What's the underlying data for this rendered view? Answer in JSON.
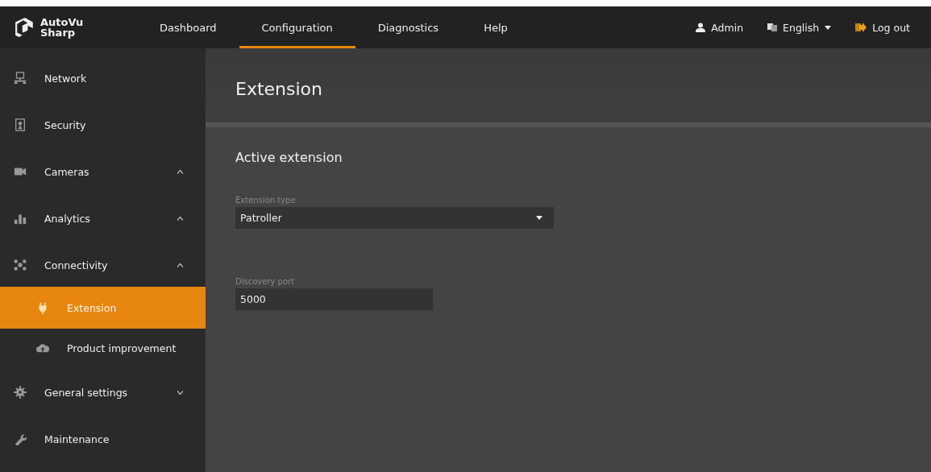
{
  "brand": {
    "line_1": "AutoVu",
    "line_2": "Sharp"
  },
  "nav": [
    {
      "label": "Dashboard",
      "selected": false
    },
    {
      "label": "Configuration",
      "selected": true
    },
    {
      "label": "Diagnostics",
      "selected": false
    },
    {
      "label": "Help",
      "selected": false
    }
  ],
  "user_menu": {
    "user": "Admin",
    "language": "English",
    "logout": "Log out"
  },
  "sidebar": {
    "items": [
      {
        "label": "Network",
        "kind": "network",
        "selected": false
      },
      {
        "label": "Security",
        "kind": "security",
        "selected": false
      },
      {
        "label": "Cameras",
        "kind": "camera",
        "selected": false,
        "expanded": true
      },
      {
        "label": "Analytics",
        "kind": "analytics",
        "selected": false,
        "expanded": true
      },
      {
        "label": "Connectivity",
        "kind": "connectivity",
        "selected": false,
        "expanded": true,
        "children": [
          {
            "label": "Extension",
            "kind": "plug",
            "selected": true
          },
          {
            "label": "Product improvement",
            "kind": "cloud",
            "selected": false
          }
        ]
      },
      {
        "label": "General settings",
        "kind": "gear",
        "selected": false,
        "expanded": false
      },
      {
        "label": "Maintenance",
        "kind": "wrench",
        "selected": false
      }
    ]
  },
  "page": {
    "title": "Extension",
    "section": "Active extension",
    "fields": [
      {
        "kind": "select",
        "label": "Extension type",
        "value": "Patroller"
      },
      {
        "kind": "input",
        "label": "Discovery port",
        "value": "5000"
      }
    ]
  }
}
